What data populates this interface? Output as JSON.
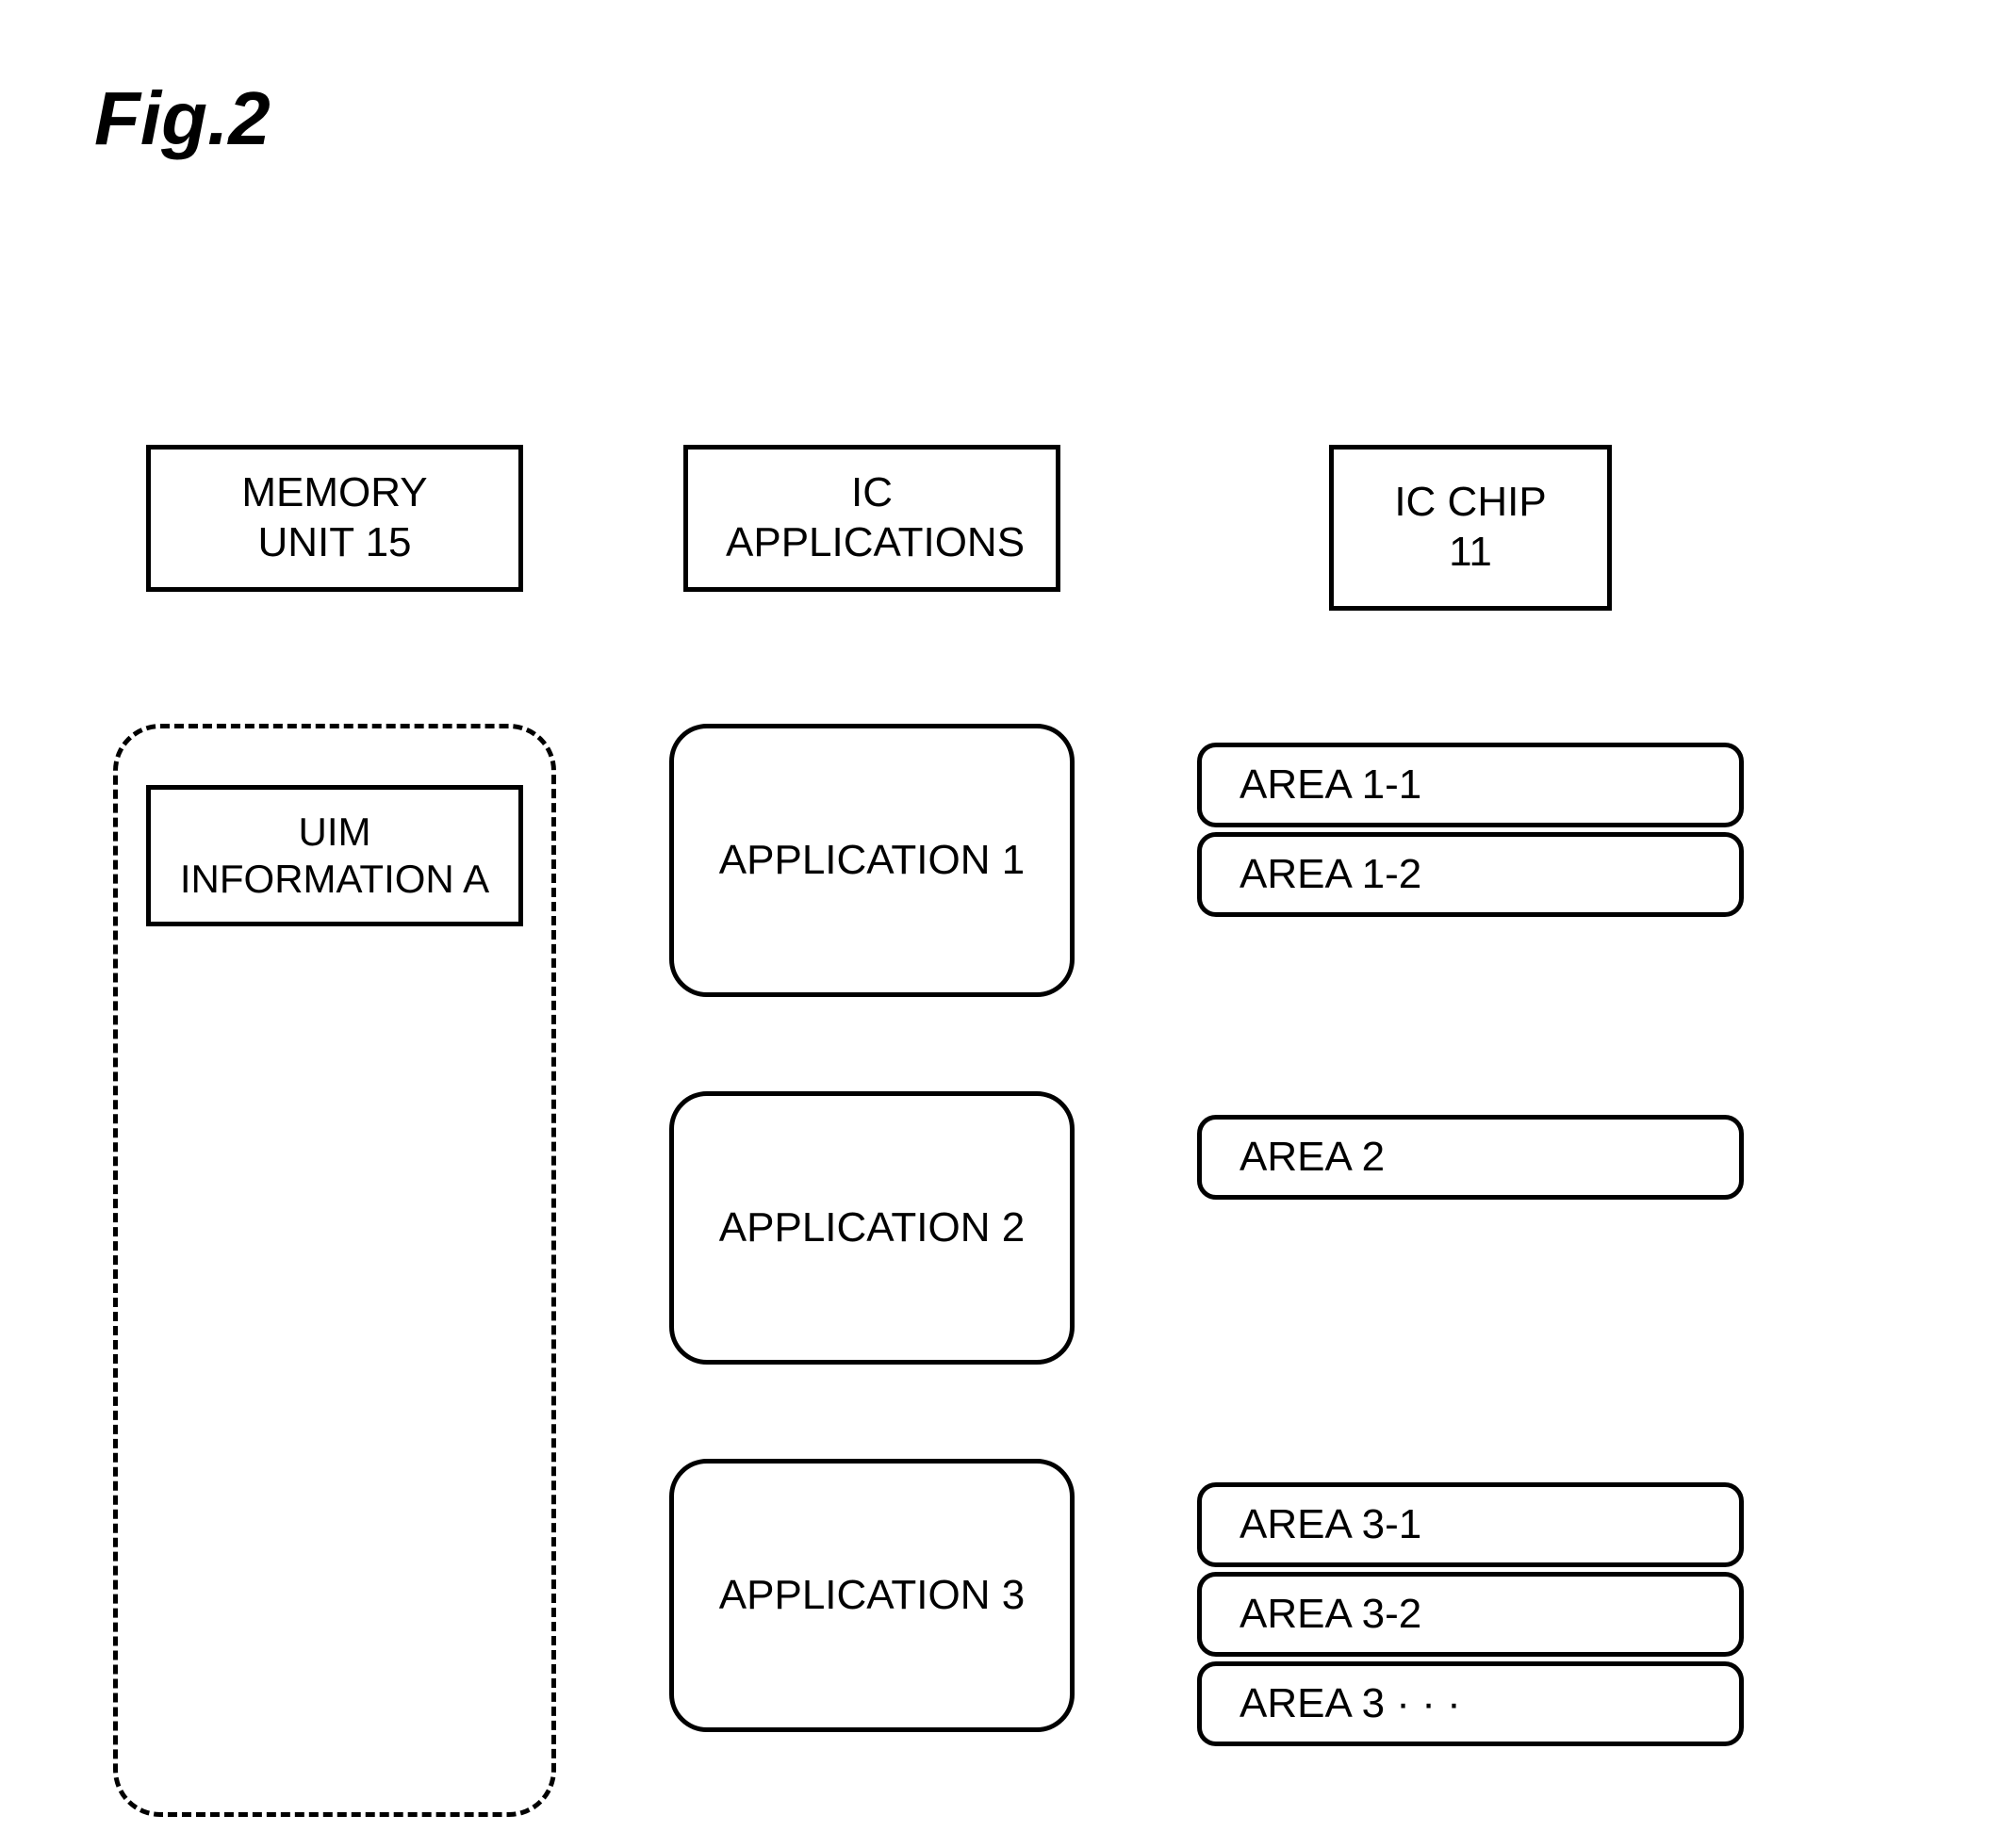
{
  "figure_title": "Fig.2",
  "headers": {
    "memory": "MEMORY UNIT 15",
    "applications": "IC APPLICATIONS",
    "chip": "IC CHIP 11"
  },
  "memory": {
    "uim_info": "UIM INFORMATION A"
  },
  "applications": [
    {
      "label": "APPLICATION 1"
    },
    {
      "label": "APPLICATION 2"
    },
    {
      "label": "APPLICATION 3"
    }
  ],
  "chip_areas": {
    "group1": [
      {
        "label": "AREA 1-1"
      },
      {
        "label": "AREA 1-2"
      }
    ],
    "group2": [
      {
        "label": "AREA 2"
      }
    ],
    "group3": [
      {
        "label": "AREA 3-1"
      },
      {
        "label": "AREA 3-2"
      },
      {
        "label": "AREA 3 · · ·"
      }
    ]
  }
}
